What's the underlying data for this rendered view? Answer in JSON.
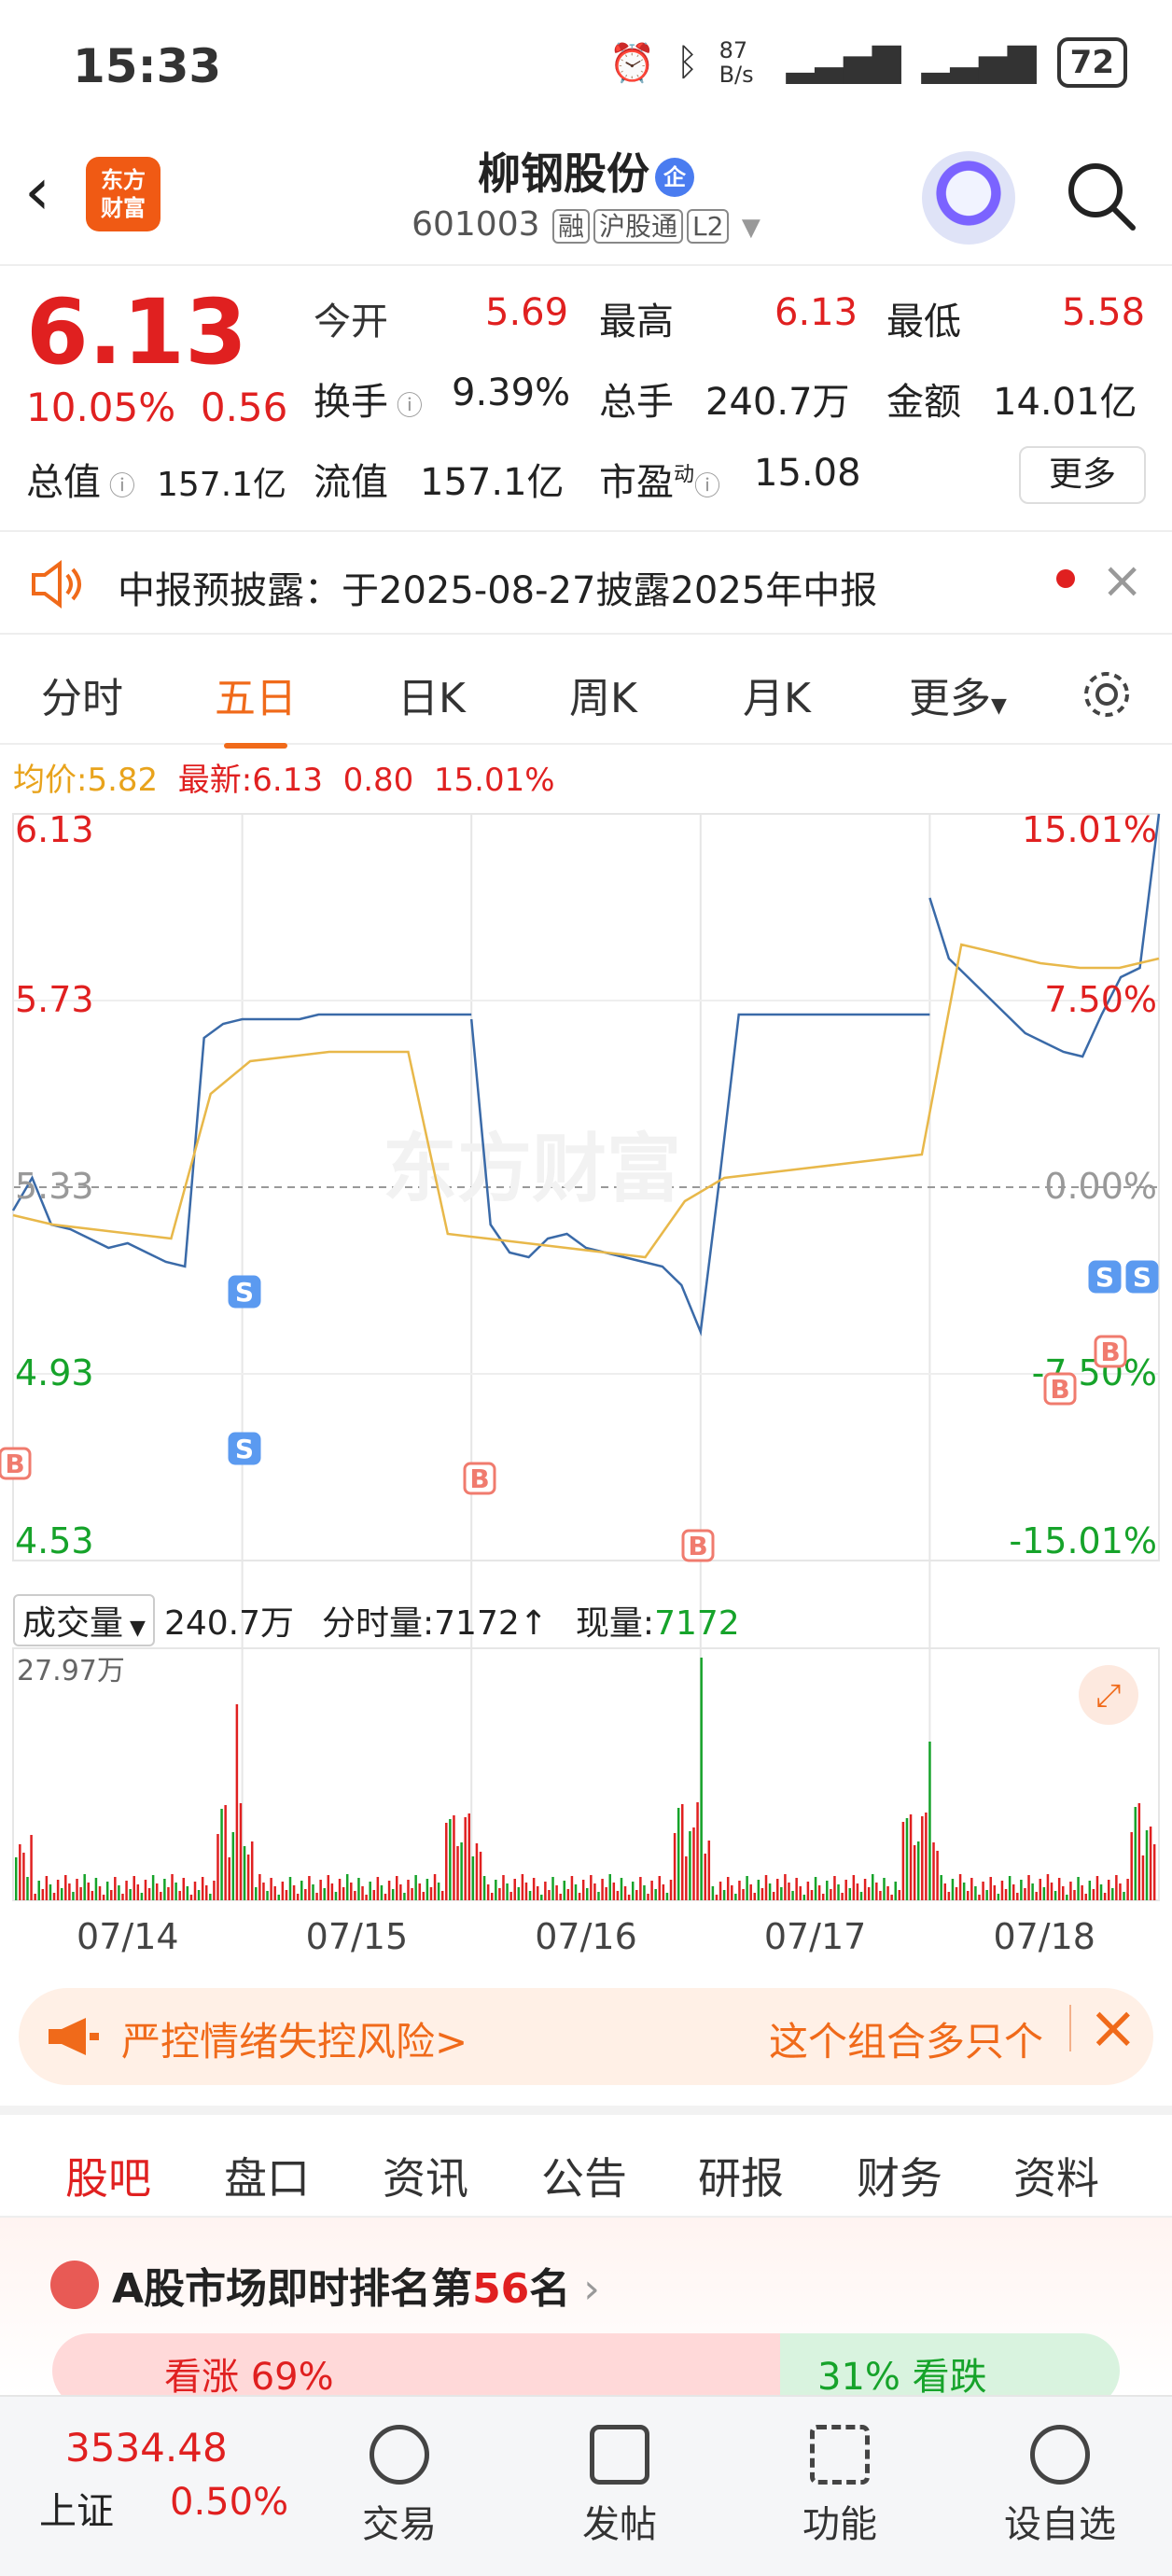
{
  "status": {
    "time": "15:33",
    "net_speed": "87 B/s",
    "battery": "72"
  },
  "header": {
    "logo_text": "东方\n财富",
    "stock_name": "柳钢股份",
    "qi_badge": "企",
    "code": "601003",
    "tags": [
      "融",
      "沪股通",
      "L2"
    ]
  },
  "quote": {
    "price": "6.13",
    "change_pct": "10.05%",
    "change": "0.56",
    "open_label": "今开",
    "open": "5.69",
    "high_label": "最高",
    "high": "6.13",
    "low_label": "最低",
    "low": "5.58",
    "turnover_label": "换手",
    "turnover": "9.39%",
    "volume_label": "总手",
    "volume": "240.7万",
    "amount_label": "金额",
    "amount": "14.01亿",
    "mktcap_label": "总值",
    "mktcap": "157.1亿",
    "float_label": "流值",
    "float_cap": "157.1亿",
    "pe_label": "市盈",
    "pe_sup": "动",
    "pe": "15.08",
    "more_label": "更多"
  },
  "notice": {
    "text": "中报预披露：于2025-08-27披露2025年中报"
  },
  "chart_tabs": [
    "分时",
    "五日",
    "日K",
    "周K",
    "月K",
    "更多"
  ],
  "chart_header": {
    "avg_label": "均价:",
    "avg": "5.82",
    "latest_label": "最新:",
    "latest": "6.13",
    "chg": "0.80",
    "pct": "15.01%"
  },
  "chart_data": {
    "type": "line",
    "left_ticks": [
      "6.13",
      "5.73",
      "5.33",
      "4.93",
      "4.53"
    ],
    "right_ticks": [
      "15.01%",
      "7.50%",
      "0.00%",
      "-7.50%",
      "-15.01%"
    ],
    "ylim": [
      4.53,
      6.13
    ],
    "x_labels": [
      "07/14",
      "07/15",
      "07/16",
      "07/17",
      "07/18"
    ],
    "series": [
      {
        "values": [
          5.28,
          5.35,
          5.25,
          5.24,
          5.22,
          5.2,
          5.21,
          5.19,
          5.17,
          5.16,
          5.65,
          5.68,
          5.69,
          5.69,
          5.69,
          5.69,
          5.7,
          5.7,
          5.7,
          5.7,
          5.7,
          5.7,
          5.7,
          5.7,
          5.7
        ]
      },
      {
        "values": [
          5.69,
          5.25,
          5.19,
          5.18,
          5.22,
          5.23,
          5.2,
          5.19,
          5.18,
          5.17,
          5.16,
          5.12,
          5.02,
          5.35,
          5.7,
          5.7,
          5.7,
          5.7,
          5.7,
          5.7,
          5.7,
          5.7,
          5.7,
          5.7,
          5.7
        ]
      },
      {
        "values": [
          5.95,
          5.82,
          5.78,
          5.74,
          5.7,
          5.66,
          5.64,
          5.62,
          5.61,
          5.7,
          5.78,
          5.8,
          6.13
        ]
      }
    ],
    "avg_series": [
      5.27,
      5.25,
      5.24,
      5.23,
      5.22,
      5.53,
      5.6,
      5.61,
      5.62,
      5.62,
      5.62,
      5.23,
      5.22,
      5.21,
      5.2,
      5.19,
      5.18,
      5.3,
      5.35,
      5.36,
      5.37,
      5.38,
      5.39,
      5.4,
      5.85,
      5.83,
      5.81,
      5.8,
      5.8,
      5.82
    ],
    "volume_max_label": "27.97万",
    "marks": [
      "B",
      "S",
      "S",
      "B",
      "B",
      "B",
      "B",
      "S",
      "S"
    ]
  },
  "volume_header": {
    "select": "成交量",
    "total": "240.7万",
    "time_vol_label": "分时量:",
    "time_vol": "7172↑",
    "now_label": "现量:",
    "now": "7172"
  },
  "ad": {
    "left": "严控情绪失控风险>",
    "right": "这个组合多只个"
  },
  "section_tabs": [
    "股吧",
    "盘口",
    "资讯",
    "公告",
    "研报",
    "财务",
    "资料"
  ],
  "rank": {
    "prefix": "A股市场即时排名第",
    "num": "56",
    "suffix": "名",
    "bull": "看涨 69%",
    "bear": "31% 看跌"
  },
  "bottom_bar": {
    "index_value": "3534.48",
    "index_name": "上证",
    "index_pct": "0.50%",
    "items": [
      "交易",
      "发帖",
      "功能",
      "设自选"
    ]
  },
  "colors": {
    "red": "#e02020",
    "green": "#16a32a",
    "orange": "#f06a1a",
    "price_line": "#3a6aa8",
    "avg_line": "#e8b84a"
  }
}
